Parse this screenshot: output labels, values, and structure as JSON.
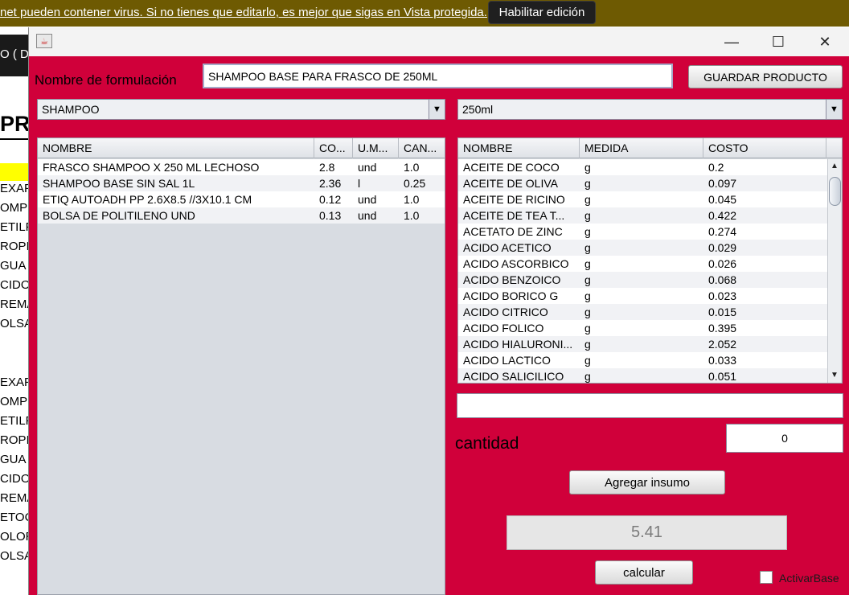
{
  "banner": {
    "message": "net pueden contener virus. Si no tienes que editarlo, es mejor que sigas en Vista protegida.",
    "enable_button": "Habilitar edición"
  },
  "excel": {
    "header_fragment": "O ( DIE",
    "title_fragment": "PRO",
    "rows": [
      "EXAPO",
      "OMPE",
      "ETILF",
      "ROPIL",
      "GUA I",
      "CIDO",
      "REMA",
      "OLSA",
      "",
      "EXAPO",
      "OMPE",
      "ETILF",
      "ROPIL",
      "GUA I",
      "CIDO",
      "REMA",
      "ETOC",
      "OLOR",
      "OLSA"
    ]
  },
  "window": {
    "formulation_label": "Nombre de formulación",
    "formulation_value": "SHAMPOO BASE PARA FRASCO DE 250ML",
    "save_button": "GUARDAR PRODUCTO",
    "category_select": "SHAMPOO",
    "size_select": "250ml",
    "left_table": {
      "columns": [
        "NOMBRE",
        "CO...",
        "U.M...",
        "CAN..."
      ],
      "rows": [
        [
          "FRASCO SHAMPOO X 250 ML LECHOSO",
          "2.8",
          "und",
          "1.0"
        ],
        [
          "SHAMPOO BASE SIN SAL 1L",
          "2.36",
          "l",
          "0.25"
        ],
        [
          "ETIQ AUTOADH PP 2.6X8.5 //3X10.1 CM",
          "0.12",
          "und",
          "1.0"
        ],
        [
          "BOLSA DE POLITILENO UND",
          "0.13",
          "und",
          "1.0"
        ]
      ]
    },
    "right_table": {
      "columns": [
        "NOMBRE",
        "MEDIDA",
        "COSTO"
      ],
      "rows": [
        [
          "ACEITE DE COCO",
          "g",
          "0.2"
        ],
        [
          "ACEITE DE OLIVA",
          "g",
          "0.097"
        ],
        [
          "ACEITE DE RICINO",
          "g",
          "0.045"
        ],
        [
          "ACEITE DE TEA T...",
          "g",
          "0.422"
        ],
        [
          "ACETATO DE ZINC",
          "g",
          "0.274"
        ],
        [
          "ACIDO ACETICO",
          "g",
          "0.029"
        ],
        [
          "ACIDO ASCORBICO",
          "g",
          "0.026"
        ],
        [
          "ACIDO BENZOICO",
          "g",
          "0.068"
        ],
        [
          "ACIDO BORICO G",
          "g",
          "0.023"
        ],
        [
          "ACIDO CITRICO",
          "g",
          "0.015"
        ],
        [
          "ACIDO FOLICO",
          "g",
          "0.395"
        ],
        [
          "ACIDO HIALURONI...",
          "g",
          "2.052"
        ],
        [
          "ACIDO LACTICO",
          "g",
          "0.033"
        ],
        [
          "ACIDO SALICILICO",
          "g",
          "0.051"
        ]
      ]
    },
    "search_value": "",
    "quantity_label": "cantidad",
    "quantity_value": "0",
    "add_button": "Agregar insumo",
    "total_value": "5.41",
    "calc_button": "calcular",
    "activar_base_label": "ActivarBase"
  }
}
